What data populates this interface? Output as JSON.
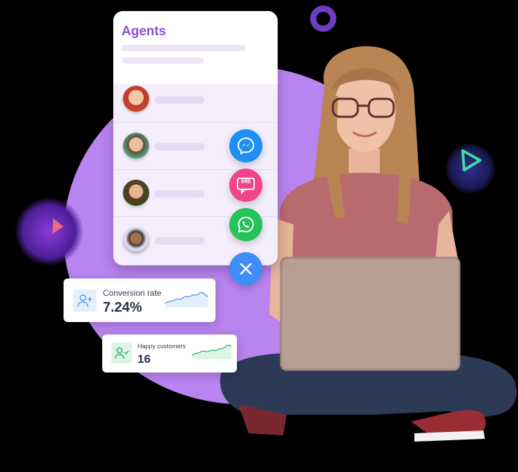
{
  "agents_card": {
    "title": "Agents",
    "agents": [
      {
        "avatar": "agent-avatar-1"
      },
      {
        "avatar": "agent-avatar-2"
      },
      {
        "avatar": "agent-avatar-3"
      },
      {
        "avatar": "agent-avatar-4"
      }
    ]
  },
  "channels": [
    {
      "name": "messenger",
      "icon": "messenger-icon",
      "color": "#1e90f5"
    },
    {
      "name": "sms",
      "icon": "sms-icon",
      "label": "SMS",
      "color": "#f0438a"
    },
    {
      "name": "whatsapp",
      "icon": "whatsapp-icon",
      "color": "#23c35a"
    },
    {
      "name": "close",
      "icon": "close-icon",
      "color": "#3f8ef7"
    }
  ],
  "stats": {
    "conversion": {
      "label": "Conversion rate",
      "value": "7.24%",
      "icon": "user-plus-icon",
      "color": "#5a9fe6"
    },
    "happy": {
      "label": "Happy customers",
      "value": "16",
      "icon": "user-check-icon",
      "color": "#2bb36b"
    }
  },
  "colors": {
    "accent": "#8e4fd8",
    "blob": "#b983f0"
  }
}
